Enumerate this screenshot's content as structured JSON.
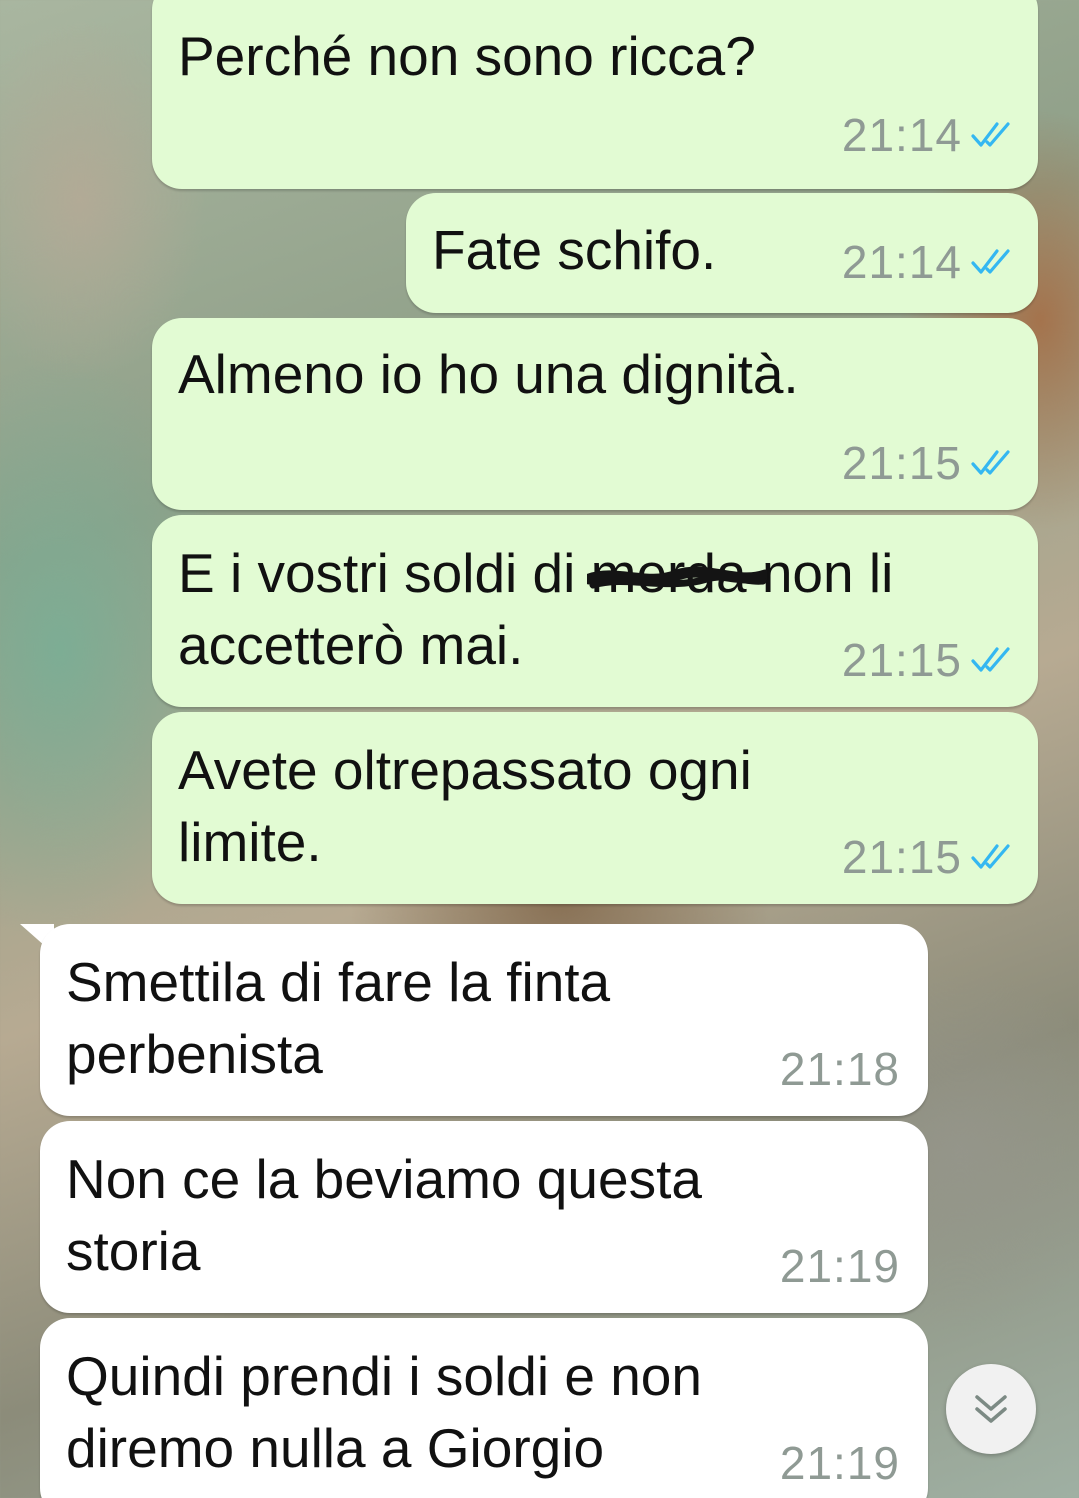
{
  "conversation": {
    "messages": [
      {
        "direction": "outgoing",
        "text": "Perché non sono ricca?",
        "time": "21:14",
        "status": "read"
      },
      {
        "direction": "outgoing",
        "text": "Fate schifo.",
        "time": "21:14",
        "status": "read"
      },
      {
        "direction": "outgoing",
        "text": "Almeno io ho una dignità.",
        "time": "21:15",
        "status": "read"
      },
      {
        "direction": "outgoing",
        "line1_before": "E i vostri soldi di ",
        "line1_scribbled": "merda",
        "line1_after": " non li",
        "line2": "accetterò mai.",
        "time": "21:15",
        "status": "read"
      },
      {
        "direction": "outgoing",
        "line1": "Avete oltrepassato ogni",
        "line2": "limite.",
        "time": "21:15",
        "status": "read"
      },
      {
        "direction": "incoming",
        "line1": "Smettila di fare la finta",
        "line2": "perbenista",
        "time": "21:18"
      },
      {
        "direction": "incoming",
        "line1": "Non ce la beviamo questa",
        "line2": "storia",
        "time": "21:19"
      },
      {
        "direction": "incoming",
        "line1": "Quindi prendi i soldi e non",
        "line2": "diremo nulla a Giorgio",
        "time": "21:19"
      }
    ]
  },
  "icons": {
    "read_receipt": "double-check-icon",
    "scroll_button": "double-chevron-down-icon"
  },
  "colors": {
    "outgoing_bubble": "#e2fbd3",
    "incoming_bubble": "#ffffff",
    "read_tick": "#34b7f1",
    "timestamp": "#8f9a94"
  }
}
